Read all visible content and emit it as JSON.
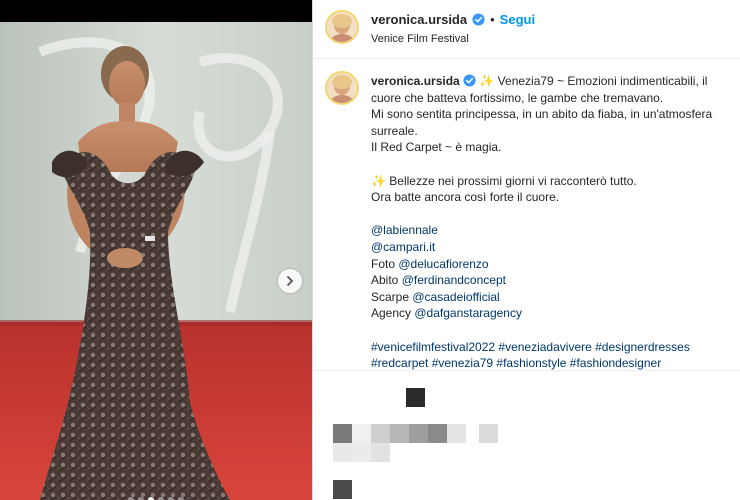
{
  "post": {
    "username": "veronica.ursida",
    "follow_label": "Segui",
    "separator": "•",
    "location": "Venice Film Festival"
  },
  "caption": {
    "username": "veronica.ursida",
    "line1": "✨ Venezia79 ~ Emozioni indimenticabili, il cuore che batteva fortissimo, le gambe che tremavano.",
    "line2": "Mi sono sentita principessa, in un abito da fiaba, in un'atmosfera surreale.",
    "line3": "Il Red Carpet ~ è magia.",
    "line4": "✨ Bellezze nei prossimi giorni vi racconterò tutto.",
    "line5": "Ora batte ancora così forte il cuore.",
    "mention1": "@labiennale",
    "mention2": "@campari.it",
    "credit_photo_label": "Foto",
    "credit_photo": "@delucafiorenzo",
    "credit_dress_label": "Abito",
    "credit_dress": "@ferdinandconcept",
    "credit_shoes_label": "Scarpe",
    "credit_shoes": "@casadeiofficial",
    "credit_agency_label": "Agency",
    "credit_agency": "@dafganstaragency",
    "hashtags": "#venicefilmfestival2022 #veneziadavivere #designerdresses",
    "hashtags_cut": "#redcarpet #venezia79 #fashionstyle #fashiondesigner"
  },
  "carousel": {
    "dots": 6,
    "active_index": 2
  },
  "icons": {
    "verified": "verified-badge-icon",
    "next": "chevron-right-icon"
  },
  "colors": {
    "link": "#00376b",
    "follow": "#0095f6",
    "verified": "#3897f0",
    "carpet": "#c3322e"
  }
}
